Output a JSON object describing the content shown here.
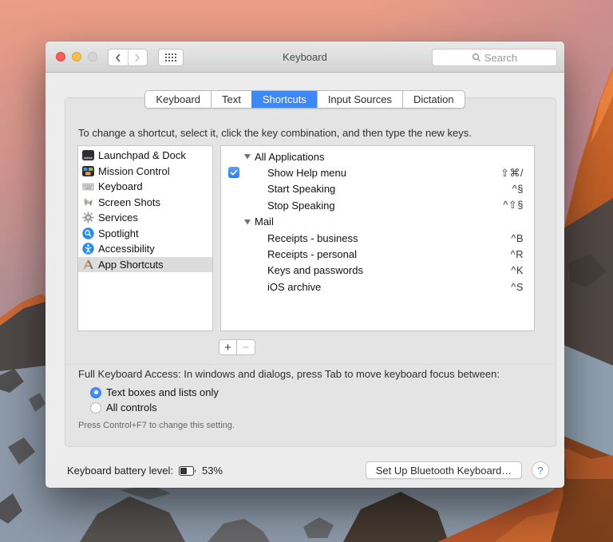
{
  "colors": {
    "accent_blue": "#3d87f6",
    "selection_gray": "#dcdcdc"
  },
  "window": {
    "title": "Keyboard",
    "search": {
      "placeholder": "Search"
    }
  },
  "tabs": [
    {
      "label": "Keyboard",
      "selected": false
    },
    {
      "label": "Text",
      "selected": false
    },
    {
      "label": "Shortcuts",
      "selected": true
    },
    {
      "label": "Input Sources",
      "selected": false
    },
    {
      "label": "Dictation",
      "selected": false
    }
  ],
  "instruction": "To change a shortcut, select it, click the key combination, and then type the new keys.",
  "categories": [
    {
      "label": "Launchpad & Dock",
      "icon": "dock-icon",
      "selected": false
    },
    {
      "label": "Mission Control",
      "icon": "mission-control-icon",
      "selected": false
    },
    {
      "label": "Keyboard",
      "icon": "keyboard-icon",
      "selected": false
    },
    {
      "label": "Screen Shots",
      "icon": "screenshot-icon",
      "selected": false
    },
    {
      "label": "Services",
      "icon": "gear-icon",
      "selected": false
    },
    {
      "label": "Spotlight",
      "icon": "spotlight-icon",
      "selected": false
    },
    {
      "label": "Accessibility",
      "icon": "accessibility-icon",
      "selected": false
    },
    {
      "label": "App Shortcuts",
      "icon": "app-shortcuts-icon",
      "selected": true
    }
  ],
  "shortcut_list": {
    "groups": [
      {
        "label": "All Applications",
        "items": [
          {
            "label": "Show Help menu",
            "keys": "⇧⌘/",
            "has_checkbox": true,
            "checked": true
          },
          {
            "label": "Start Speaking",
            "keys": "^§"
          },
          {
            "label": "Stop Speaking",
            "keys": "^⇧§"
          }
        ]
      },
      {
        "label": "Mail",
        "items": [
          {
            "label": "Receipts - business",
            "keys": "^B"
          },
          {
            "label": "Receipts - personal",
            "keys": "^R"
          },
          {
            "label": "Keys and passwords",
            "keys": "^K"
          },
          {
            "label": "iOS archive",
            "keys": "^S"
          }
        ]
      }
    ],
    "add_label": "+",
    "remove_label": "−"
  },
  "full_keyboard_access": {
    "heading": "Full Keyboard Access: In windows and dialogs, press Tab to move keyboard focus between:",
    "options": [
      {
        "label": "Text boxes and lists only",
        "selected": true
      },
      {
        "label": "All controls",
        "selected": false
      }
    ],
    "note": "Press Control+F7 to change this setting."
  },
  "footer": {
    "battery_label": "Keyboard battery level:",
    "battery_percent": "53%",
    "setup_button": "Set Up Bluetooth Keyboard…",
    "help_button": "?"
  }
}
